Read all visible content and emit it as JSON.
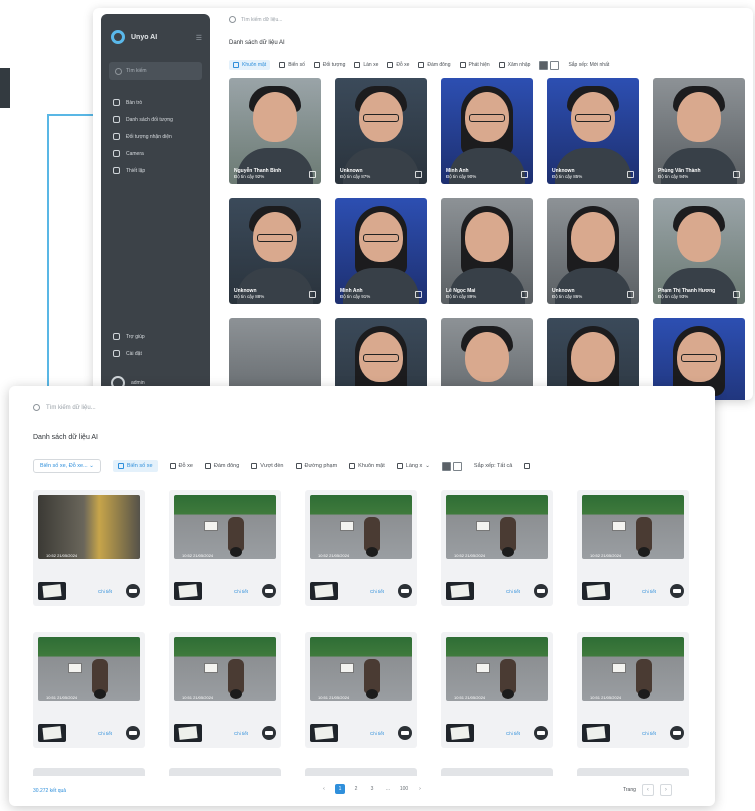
{
  "colors": {
    "accent": "#2f8fdb",
    "sidebar": "#3c4248",
    "connector": "#59b7e5"
  },
  "back": {
    "brand": "Unyo AI",
    "sidebar_search": "Tìm kiếm",
    "nav": [
      {
        "label": "Bàn trò",
        "icon": "home-icon"
      },
      {
        "label": "Danh sách đối tượng",
        "icon": "list-icon"
      },
      {
        "label": "Đối tượng nhận diện",
        "icon": "face-scan-icon"
      },
      {
        "label": "Camera",
        "icon": "camera-icon"
      },
      {
        "label": "Thiết lập",
        "icon": "settings-icon"
      }
    ],
    "nav_bottom": [
      {
        "label": "Trợ giúp",
        "icon": "help-icon"
      },
      {
        "label": "Cài đặt",
        "icon": "gear-icon"
      }
    ],
    "user": "admin",
    "search_placeholder": "Tìm kiếm dữ liệu...",
    "title": "Danh sách dữ liệu AI",
    "filters": [
      "Khuôn mặt",
      "Biển số",
      "Đối tượng",
      "Làn xe",
      "Đỗ xe",
      "Đám đông",
      "Phát hiện",
      "Xâm nhập"
    ],
    "view_label": "Sắp xếp: Mới nhất",
    "faces": [
      {
        "name": "Nguyễn Thanh Bình",
        "meta": "Độ tin cậy 92%"
      },
      {
        "name": "Unknown",
        "meta": "Độ tin cậy 87%"
      },
      {
        "name": "Minh Anh",
        "meta": "Độ tin cậy 90%"
      },
      {
        "name": "Unknown",
        "meta": "Độ tin cậy 85%"
      },
      {
        "name": "Phùng Văn Thành",
        "meta": "Độ tin cậy 94%"
      },
      {
        "name": "Unknown",
        "meta": "Độ tin cậy 88%"
      },
      {
        "name": "Minh Anh",
        "meta": "Độ tin cậy 91%"
      },
      {
        "name": "Lê Ngọc Mai",
        "meta": "Độ tin cậy 89%"
      },
      {
        "name": "Unknown",
        "meta": "Độ tin cậy 86%"
      },
      {
        "name": "Phạm Thị Thanh Hương",
        "meta": "Độ tin cậy 93%"
      },
      {
        "name": "",
        "meta": ""
      },
      {
        "name": "",
        "meta": ""
      },
      {
        "name": "",
        "meta": ""
      },
      {
        "name": "",
        "meta": ""
      },
      {
        "name": "",
        "meta": ""
      }
    ]
  },
  "front": {
    "search_placeholder": "Tìm kiếm dữ liệu...",
    "title": "Danh sách dữ liệu AI",
    "select_value": "Biển số xe, Đỗ xe...",
    "filters": [
      "Biển số xe",
      "Đỗ xe",
      "Đám đông",
      "Vượt đèn",
      "Đường phạm",
      "Khuôn mặt",
      "Làng x"
    ],
    "view_label": "Sắp xếp: Tất cả",
    "scene_link": "Chi tiết",
    "scenes": [
      {
        "time": "10:52 21/05/2024"
      },
      {
        "time": "10:52 21/05/2024"
      },
      {
        "time": "10:52 21/05/2024"
      },
      {
        "time": "10:52 21/05/2024"
      },
      {
        "time": "10:52 21/05/2024"
      },
      {
        "time": "10:51 21/05/2024"
      },
      {
        "time": "10:51 21/05/2024"
      },
      {
        "time": "10:51 21/05/2024"
      },
      {
        "time": "10:51 21/05/2024"
      },
      {
        "time": "10:51 21/05/2024"
      }
    ],
    "total": "30.272 kết quả",
    "pages": [
      "1",
      "2",
      "3",
      "...",
      "100"
    ],
    "page_prev": "‹",
    "page_next": "›",
    "page_label": "Trang",
    "nav_left": "‹",
    "nav_right": "›"
  }
}
